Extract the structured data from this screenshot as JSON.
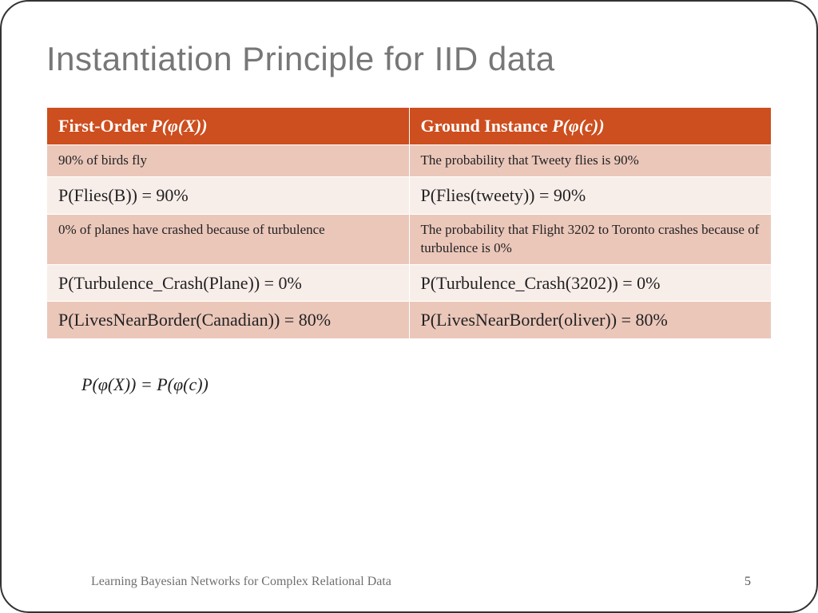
{
  "title": "Instantiation Principle for IID data",
  "headers": {
    "left_prefix": "First-Order  ",
    "left_ital": "P(φ(X))",
    "right_prefix": "Ground Instance  ",
    "right_ital": "P(φ(c))"
  },
  "rows": [
    {
      "cls": "r-small",
      "l": "90% of birds fly",
      "r": "The probability that Tweety flies is 90%"
    },
    {
      "cls": "r-big",
      "l": "P(Flies(B)) = 90%",
      "r": "P(Flies(tweety)) = 90%"
    },
    {
      "cls": "r-small",
      "l": "0% of planes have crashed because of turbulence",
      "r": "The probability that Flight 3202 to Toronto crashes because of turbulence is 0%"
    },
    {
      "cls": "r-big",
      "l": "P(Turbulence_Crash(Plane)) = 0%",
      "r": "P(Turbulence_Crash(3202)) = 0%"
    },
    {
      "cls": "r-med",
      "l": "P(LivesNearBorder(Canadian)) = 80%",
      "r": "P(LivesNearBorder(oliver)) = 80%"
    }
  ],
  "equation": "P(φ(X)) = P(φ(c))",
  "footer": {
    "source": "Learning Bayesian Networks for Complex Relational Data",
    "page": "5"
  }
}
